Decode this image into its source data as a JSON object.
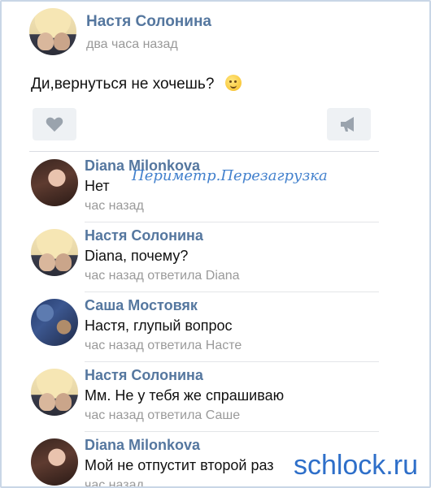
{
  "post": {
    "author": "Настя Солонина",
    "time": "два часа назад",
    "text": "Ди,вернуться не хочешь?",
    "emoji_icon": "wink-emoji-icon",
    "like_icon": "heart-icon",
    "share_icon": "megaphone-icon"
  },
  "comments": [
    {
      "author": "Diana Milonkova",
      "text": "Нет",
      "meta": "час назад"
    },
    {
      "author": "Настя Солонина",
      "text": "Diana, почему?",
      "meta": "час назад ответила Diana"
    },
    {
      "author": "Саша Мостовяк",
      "text": "Настя, глупый вопрос",
      "meta": "час назад ответила Насте"
    },
    {
      "author": "Настя Солонина",
      "text": "Мм. Не у тебя же спрашиваю",
      "meta": "час назад ответила Саше"
    },
    {
      "author": "Diana Milonkova",
      "text": "Мой не отпустит второй раз",
      "meta": "час назад"
    }
  ],
  "watermarks": {
    "center": "Периметр.Перезагрузка",
    "corner": "schlock.ru"
  },
  "colors": {
    "name": "#55779f",
    "meta": "#9a9a9a",
    "button_bg": "#eef1f4",
    "watermark": "#2e6fc9"
  }
}
